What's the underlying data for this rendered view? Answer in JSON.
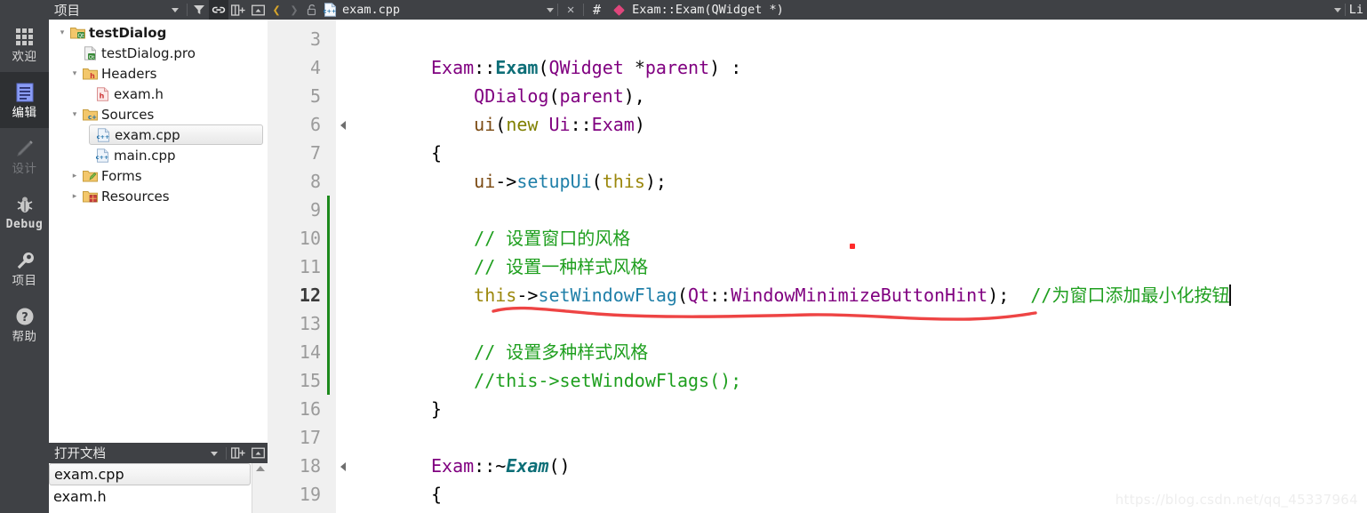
{
  "modebar": {
    "items": [
      {
        "id": "welcome",
        "label": "欢迎",
        "icon": "grid-icon",
        "active": false,
        "dim": false
      },
      {
        "id": "edit",
        "label": "编辑",
        "icon": "document-icon",
        "active": true,
        "dim": false
      },
      {
        "id": "design",
        "label": "设计",
        "icon": "pencil-icon",
        "active": false,
        "dim": true
      },
      {
        "id": "debug",
        "label": "Debug",
        "icon": "bug-icon",
        "active": false,
        "dim": false
      },
      {
        "id": "projects",
        "label": "项目",
        "icon": "wrench-icon",
        "active": false,
        "dim": false
      },
      {
        "id": "help",
        "label": "帮助",
        "icon": "question-icon",
        "active": false,
        "dim": false
      }
    ]
  },
  "project_panel": {
    "title": "项目",
    "dropdown_icon": "chevron-down-icon",
    "buttons": [
      {
        "id": "filter",
        "icon": "filter-icon",
        "active": false
      },
      {
        "id": "link",
        "icon": "link-icon",
        "active": true
      },
      {
        "id": "split",
        "icon": "split-icon",
        "active": false
      },
      {
        "id": "close",
        "icon": "collapse-icon",
        "active": false
      }
    ],
    "tree": [
      {
        "label": "testDialog",
        "indent": 0,
        "arrow": "down",
        "icon": "qt-project-icon",
        "bold": true,
        "selected": false
      },
      {
        "label": "testDialog.pro",
        "indent": 1,
        "arrow": "none",
        "icon": "pro-file-icon",
        "bold": false,
        "selected": false
      },
      {
        "label": "Headers",
        "indent": 0,
        "arrow": "down",
        "icon": "folder-h-icon",
        "bold": false,
        "selected": false
      },
      {
        "label": "exam.h",
        "indent": 1,
        "arrow": "none",
        "icon": "header-file-icon",
        "bold": false,
        "selected": false
      },
      {
        "label": "Sources",
        "indent": 0,
        "arrow": "down",
        "icon": "folder-cpp-icon",
        "bold": false,
        "selected": false
      },
      {
        "label": "exam.cpp",
        "indent": 1,
        "arrow": "none",
        "icon": "cpp-file-icon",
        "bold": false,
        "selected": true
      },
      {
        "label": "main.cpp",
        "indent": 1,
        "arrow": "none",
        "icon": "cpp-file-icon",
        "bold": false,
        "selected": false
      },
      {
        "label": "Forms",
        "indent": 0,
        "arrow": "right",
        "icon": "folder-form-icon",
        "bold": false,
        "selected": false
      },
      {
        "label": "Resources",
        "indent": 0,
        "arrow": "right",
        "icon": "folder-res-icon",
        "bold": false,
        "selected": false
      }
    ]
  },
  "open_documents": {
    "title": "打开文档",
    "dropdown_icon": "chevron-down-icon",
    "buttons": [
      {
        "id": "split",
        "icon": "split-icon"
      },
      {
        "id": "close",
        "icon": "collapse-icon"
      }
    ],
    "items": [
      {
        "label": "exam.cpp",
        "selected": true
      },
      {
        "label": "exam.h",
        "selected": false
      }
    ]
  },
  "editor_toolbar": {
    "back_icon": "chevron-left-icon",
    "forward_icon": "chevron-right-icon",
    "lock_icon": "unlocked-icon",
    "file_icon": "cpp-file-icon",
    "filename": "exam.cpp",
    "file_dropdown_icon": "chevron-down-icon",
    "close_icon": "close-icon",
    "hash_label": "#",
    "symbol_marker_icon": "diamond-icon",
    "symbol": "Exam::Exam(QWidget *)",
    "symbol_dropdown_icon": "chevron-down-icon",
    "status_text": "Li"
  },
  "code": {
    "first_line": 3,
    "current_line": 12,
    "change_bar_from": 9,
    "change_bar_to": 15,
    "lines": [
      {
        "n": 3,
        "fold": false,
        "tokens": []
      },
      {
        "n": 4,
        "fold": false,
        "tokens": [
          {
            "t": "Exam",
            "c": "cls"
          },
          {
            "t": "::",
            "c": "punc"
          },
          {
            "t": "Exam",
            "c": "fn"
          },
          {
            "t": "(",
            "c": "punc"
          },
          {
            "t": "QWidget",
            "c": "cls"
          },
          {
            "t": " *",
            "c": "plain"
          },
          {
            "t": "parent",
            "c": "cls"
          },
          {
            "t": ") :",
            "c": "punc"
          }
        ]
      },
      {
        "n": 5,
        "fold": false,
        "tokens": [
          {
            "t": "    ",
            "c": "plain"
          },
          {
            "t": "QDialog",
            "c": "cls"
          },
          {
            "t": "(",
            "c": "punc"
          },
          {
            "t": "parent",
            "c": "cls"
          },
          {
            "t": "),",
            "c": "punc"
          }
        ]
      },
      {
        "n": 6,
        "fold": true,
        "tokens": [
          {
            "t": "    ",
            "c": "plain"
          },
          {
            "t": "ui",
            "c": "var"
          },
          {
            "t": "(",
            "c": "punc"
          },
          {
            "t": "new",
            "c": "kw"
          },
          {
            "t": " ",
            "c": "plain"
          },
          {
            "t": "Ui",
            "c": "cls"
          },
          {
            "t": "::",
            "c": "punc"
          },
          {
            "t": "Exam",
            "c": "cls"
          },
          {
            "t": ")",
            "c": "punc"
          }
        ]
      },
      {
        "n": 7,
        "fold": false,
        "tokens": [
          {
            "t": "{",
            "c": "punc"
          }
        ]
      },
      {
        "n": 8,
        "fold": false,
        "tokens": [
          {
            "t": "    ",
            "c": "plain"
          },
          {
            "t": "ui",
            "c": "var"
          },
          {
            "t": "->",
            "c": "punc"
          },
          {
            "t": "setupUi",
            "c": "mem"
          },
          {
            "t": "(",
            "c": "punc"
          },
          {
            "t": "this",
            "c": "kw2"
          },
          {
            "t": ");",
            "c": "punc"
          }
        ]
      },
      {
        "n": 9,
        "fold": false,
        "tokens": []
      },
      {
        "n": 10,
        "fold": false,
        "tokens": [
          {
            "t": "    // 设置窗口的风格",
            "c": "cmt"
          }
        ]
      },
      {
        "n": 11,
        "fold": false,
        "tokens": [
          {
            "t": "    // 设置一种样式风格",
            "c": "cmt"
          }
        ]
      },
      {
        "n": 12,
        "fold": false,
        "tokens": [
          {
            "t": "    ",
            "c": "plain"
          },
          {
            "t": "this",
            "c": "kw2"
          },
          {
            "t": "->",
            "c": "punc"
          },
          {
            "t": "setWindowFlag",
            "c": "mem"
          },
          {
            "t": "(",
            "c": "punc"
          },
          {
            "t": "Qt",
            "c": "cls"
          },
          {
            "t": "::",
            "c": "punc"
          },
          {
            "t": "WindowMinimizeButtonHint",
            "c": "cls"
          },
          {
            "t": ");  ",
            "c": "punc"
          },
          {
            "t": "//为窗口添加最小化按钮",
            "c": "cmt"
          }
        ]
      },
      {
        "n": 13,
        "fold": false,
        "tokens": []
      },
      {
        "n": 14,
        "fold": false,
        "tokens": [
          {
            "t": "    // 设置多种样式风格",
            "c": "cmt"
          }
        ]
      },
      {
        "n": 15,
        "fold": false,
        "tokens": [
          {
            "t": "    //this->setWindowFlags();",
            "c": "cmt"
          }
        ]
      },
      {
        "n": 16,
        "fold": false,
        "tokens": [
          {
            "t": "}",
            "c": "punc"
          }
        ]
      },
      {
        "n": 17,
        "fold": false,
        "tokens": []
      },
      {
        "n": 18,
        "fold": true,
        "tokens": [
          {
            "t": "Exam",
            "c": "cls"
          },
          {
            "t": "::~",
            "c": "punc"
          },
          {
            "t": "Exam",
            "c": "fnit"
          },
          {
            "t": "()",
            "c": "punc"
          }
        ]
      },
      {
        "n": 19,
        "fold": false,
        "tokens": [
          {
            "t": "{",
            "c": "punc"
          }
        ]
      }
    ]
  },
  "annotations": {
    "underline_color": "#ee4444",
    "dot_color": "#ff2b2b"
  },
  "watermark": "https://blog.csdn.net/qq_45337964"
}
